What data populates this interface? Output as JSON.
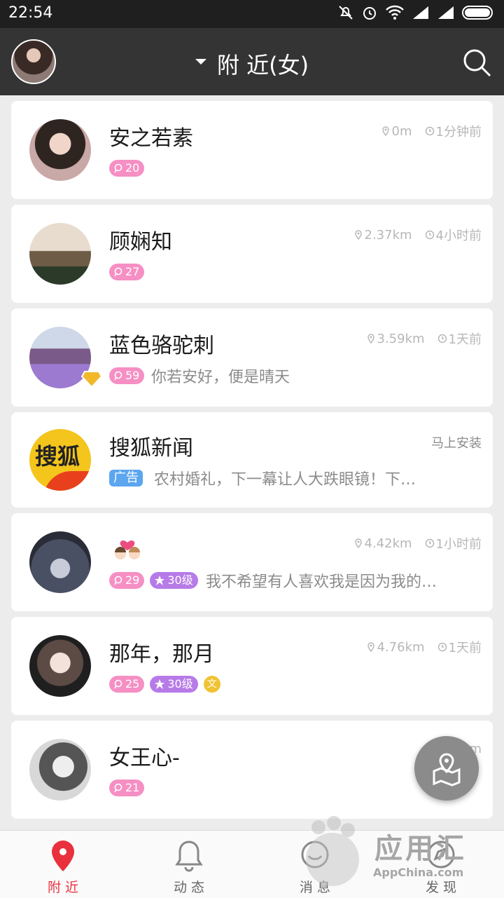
{
  "status_bar": {
    "time": "22:54",
    "icons": [
      "mute-icon",
      "alarm-icon",
      "wifi-icon",
      "signal-icon",
      "signal-icon",
      "battery-icon"
    ]
  },
  "header": {
    "title": "附 近(女)",
    "icon_dropdown": "caret-down-icon",
    "icon_search": "search-icon"
  },
  "users": [
    {
      "name": "安之若素",
      "distance": "0m",
      "time": "1分钟前",
      "badges": [
        {
          "type": "pink",
          "text": "20"
        }
      ],
      "signature": ""
    },
    {
      "name": "顾娴知",
      "distance": "2.37km",
      "time": "4小时前",
      "badges": [
        {
          "type": "pink",
          "text": "27"
        }
      ],
      "signature": ""
    },
    {
      "name": "蓝色骆驼刺",
      "distance": "3.59km",
      "time": "1天前",
      "badges": [
        {
          "type": "pink",
          "text": "59"
        }
      ],
      "signature": "你若安好，便是晴天"
    },
    {
      "name": "搜狐新闻",
      "action": "马上安装",
      "badges": [
        {
          "type": "ad",
          "text": "广告"
        }
      ],
      "signature": "农村婚礼，下一幕让人大跌眼镜！下…",
      "logo_text": "搜狐"
    },
    {
      "name": "",
      "distance": "4.42km",
      "time": "1小时前",
      "badges": [
        {
          "type": "pink",
          "text": "29"
        },
        {
          "type": "purple",
          "text": "30级"
        }
      ],
      "signature": "我不希望有人喜欢我是因为我的…"
    },
    {
      "name": "那年，那月",
      "distance": "4.76km",
      "time": "1天前",
      "badges": [
        {
          "type": "pink",
          "text": "25"
        },
        {
          "type": "purple",
          "text": "30级"
        },
        {
          "type": "gold",
          "text": "文"
        }
      ],
      "signature": ""
    },
    {
      "name": "女王心-",
      "distance": "4.88km",
      "time": "",
      "badges": [
        {
          "type": "pink",
          "text": "21"
        }
      ],
      "signature": ""
    }
  ],
  "fab": {
    "icon": "map-location-icon"
  },
  "bottom_nav": [
    {
      "label": "附 近",
      "icon": "location-pin-icon",
      "active": true
    },
    {
      "label": "动 态",
      "icon": "bell-icon",
      "active": false
    },
    {
      "label": "消 息",
      "icon": "message-icon",
      "active": false
    },
    {
      "label": "发 现",
      "icon": "discover-icon",
      "active": false
    }
  ],
  "watermark": {
    "text": "应用汇",
    "sub": "AppChina.com"
  },
  "colors": {
    "accent": "#e8313c",
    "header": "#343434",
    "pink_badge": "#f58fc4",
    "purple_badge": "#b77be8",
    "ad_badge": "#5ba6ef"
  }
}
